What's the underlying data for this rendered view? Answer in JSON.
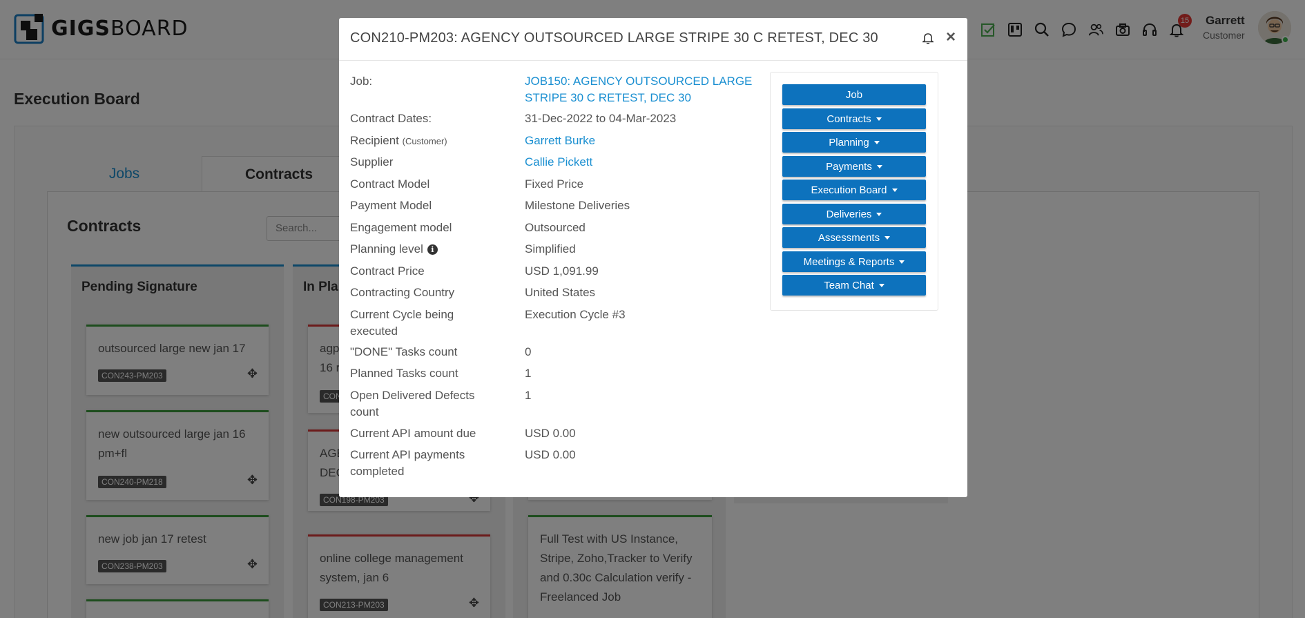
{
  "header": {
    "logo_bold": "GIGS",
    "logo_light": "BOARD",
    "notification_count": "15",
    "user_name": "Garrett",
    "user_role": "Customer"
  },
  "page": {
    "title": "Execution Board",
    "tabs": [
      "Jobs",
      "Contracts"
    ],
    "contracts_heading": "Contracts",
    "search_placeholder": "Search..."
  },
  "columns": {
    "pending": {
      "title": "Pending Signature",
      "cards": [
        {
          "text": "outsourced large new jan 17",
          "code": "CON243-PM203"
        },
        {
          "text": "new outsourced large jan 16 pm+fl",
          "code": "CON240-PM218"
        },
        {
          "text": "new job jan 17 retest",
          "code": "CON238-PM203"
        }
      ]
    },
    "in_planning": {
      "title": "In Pla",
      "cards": [
        {
          "text": "agp\n16 re",
          "code": "CON"
        },
        {
          "text": "AGE\nDEC",
          "code": "CON198-PM203"
        },
        {
          "text": "online college management system, jan 6",
          "code": "CON213-PM203"
        }
      ]
    },
    "third": {
      "cards": [
        {
          "text": "Full Test with US Instance, Stripe, Zoho,Tracker to Verify and 0.30c Calculation verify - Freelanced Job"
        }
      ]
    }
  },
  "modal": {
    "title": "CON210-PM203: AGENCY OUTSOURCED LARGE STRIPE 30 C RETEST, DEC 30",
    "close": "×",
    "rows": [
      {
        "label": "Job:",
        "value": "JOB150: AGENCY OUTSOURCED LARGE STRIPE 30 C RETEST, DEC 30"
      },
      {
        "label": "Contract Dates:",
        "value": "31-Dec-2022 to 04-Mar-2023"
      },
      {
        "label": "Recipient",
        "label_sub": "(Customer)",
        "value": "Garrett Burke"
      },
      {
        "label": "Supplier",
        "value": "Callie Pickett"
      },
      {
        "label": "Contract Model",
        "value": "Fixed Price"
      },
      {
        "label": "Payment Model",
        "value": "Milestone Deliveries"
      },
      {
        "label": "Engagement model",
        "value": "Outsourced"
      },
      {
        "label": "Planning level",
        "value": "Simplified"
      },
      {
        "label": "Contract Price",
        "value": "USD 1,091.99"
      },
      {
        "label": "Contracting Country",
        "value": "United States"
      },
      {
        "label": "Current Cycle being executed",
        "value": "Execution Cycle #3"
      },
      {
        "label": "\"DONE\" Tasks count",
        "value": "0"
      },
      {
        "label": "Planned Tasks count",
        "value": "1"
      },
      {
        "label": "Open Delivered Defects count",
        "value": "1"
      },
      {
        "label": "Current API amount due",
        "value": "USD 0.00"
      },
      {
        "label": "Current API payments completed",
        "value": "USD 0.00"
      }
    ],
    "actions": [
      "Job",
      "Contracts",
      "Planning",
      "Payments",
      "Execution Board",
      "Deliveries",
      "Assessments",
      "Meetings & Reports",
      "Team Chat"
    ]
  },
  "colors": {
    "primary_button": "#0d72bd",
    "link": "#1a8fd1",
    "green_card": "#3a9a3a",
    "red_card": "#d93636"
  }
}
